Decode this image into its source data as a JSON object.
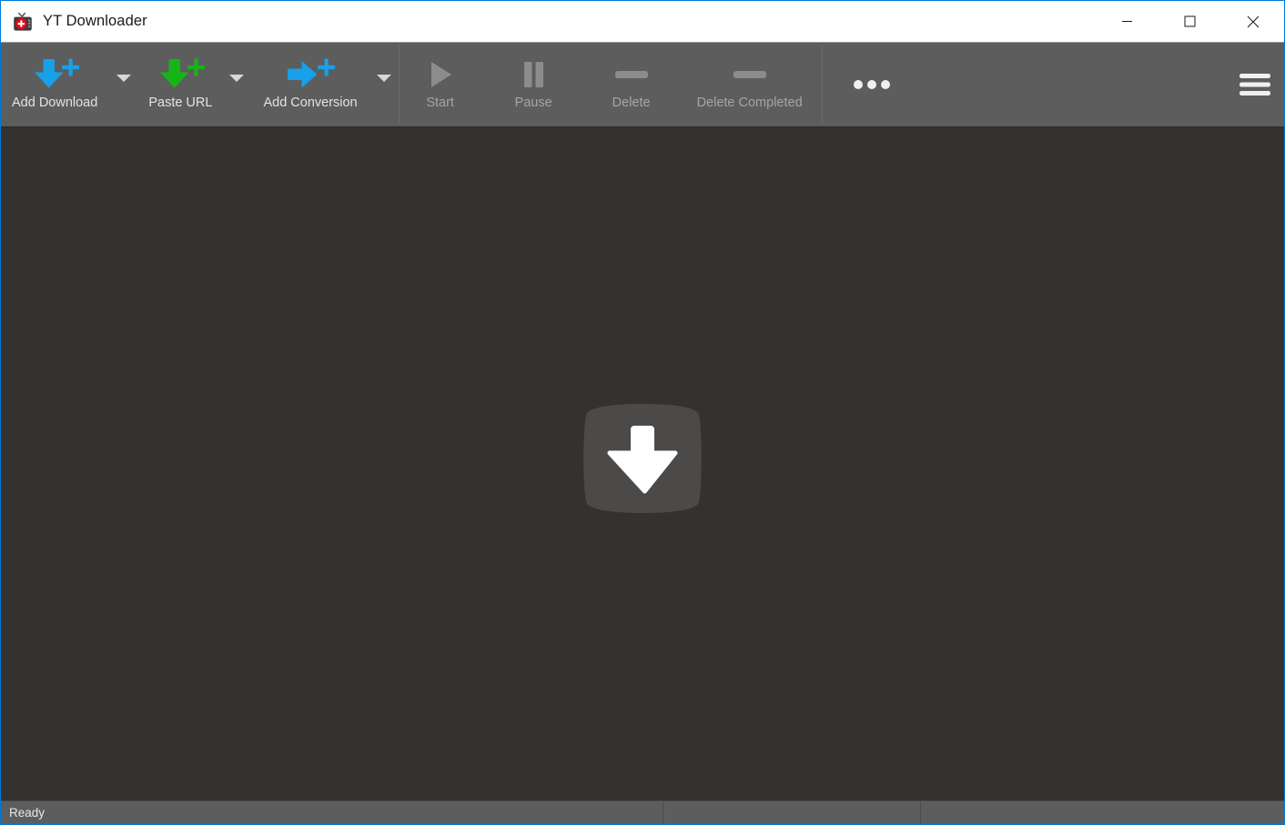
{
  "window": {
    "title": "YT Downloader",
    "app_icon": "tv-icon",
    "border_color": "#0078d7",
    "titlebar_background": "#ffffff",
    "toolbar_background": "#5d5d5d",
    "content_background": "#333231",
    "statusbar_background": "#5d5d5d",
    "controls": [
      {
        "name": "minimize-button",
        "icon": "minimize-icon",
        "label": "Minimize"
      },
      {
        "name": "maximize-button",
        "icon": "maximize-icon",
        "label": "Maximize"
      },
      {
        "name": "close-button",
        "icon": "close-icon",
        "label": "Close"
      }
    ]
  },
  "toolbar": {
    "primary": [
      {
        "label": "Add Download",
        "icon": "add-download-icon",
        "icon_color": "#18a0e8",
        "has_dropdown": true,
        "enabled": true
      },
      {
        "label": "Paste URL",
        "icon": "paste-url-icon",
        "icon_color": "#16b516",
        "has_dropdown": true,
        "enabled": true
      },
      {
        "label": "Add Conversion",
        "icon": "add-conversion-icon",
        "icon_color": "#18a0e8",
        "has_dropdown": true,
        "enabled": true
      }
    ],
    "transport": [
      {
        "label": "Start",
        "icon": "play-icon",
        "icon_color": "#8c8c8c",
        "enabled": false
      },
      {
        "label": "Pause",
        "icon": "pause-icon",
        "icon_color": "#8c8c8c",
        "enabled": false
      },
      {
        "label": "Delete",
        "icon": "minus-icon",
        "icon_color": "#8c8c8c",
        "enabled": false
      },
      {
        "label": "Delete Completed",
        "icon": "minus-icon",
        "icon_color": "#8c8c8c",
        "enabled": false
      }
    ],
    "overflow": {
      "name": "more-options-button",
      "icon": "ellipsis-icon",
      "icon_color": "#f0f0f0"
    },
    "menu": {
      "name": "main-menu-button",
      "icon": "hamburger-menu-icon",
      "icon_color": "#f0f0f0"
    }
  },
  "main": {
    "placeholder_icon": "download-placeholder-icon",
    "placeholder_badge_color": "#4b4a49",
    "placeholder_arrow_color": "#ffffff"
  },
  "statusbar": {
    "message": "Ready",
    "panel_2": "",
    "panel_3": ""
  }
}
